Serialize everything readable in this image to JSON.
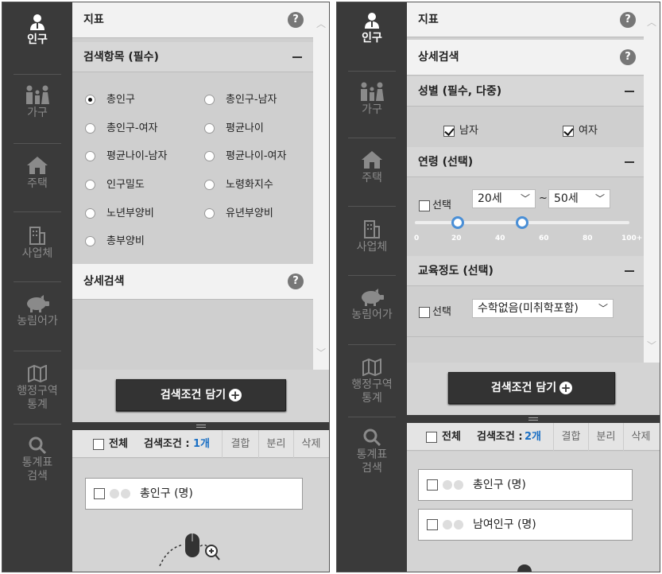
{
  "sidebar": {
    "items": [
      {
        "label": "인구",
        "icon": "person-icon"
      },
      {
        "label": "가구",
        "icon": "family-icon"
      },
      {
        "label": "주택",
        "icon": "house-icon"
      },
      {
        "label": "사업체",
        "icon": "building-icon"
      },
      {
        "label": "농림어가",
        "icon": "pig-icon"
      },
      {
        "label_line1": "행정구역",
        "label_line2": "통계",
        "icon": "map-icon"
      },
      {
        "label_line1": "통계표",
        "label_line2": "검색",
        "icon": "search-icon"
      }
    ]
  },
  "left": {
    "indicator_title": "지표",
    "search_items_title": "검색항목 (필수)",
    "radios": [
      {
        "label": "총인구",
        "checked": true
      },
      {
        "label": "총인구-남자",
        "checked": false
      },
      {
        "label": "총인구-여자",
        "checked": false
      },
      {
        "label": "평균나이",
        "checked": false
      },
      {
        "label": "평균나이-남자",
        "checked": false
      },
      {
        "label": "평균나이-여자",
        "checked": false
      },
      {
        "label": "인구밀도",
        "checked": false
      },
      {
        "label": "노령화지수",
        "checked": false
      },
      {
        "label": "노년부양비",
        "checked": false
      },
      {
        "label": "유년부양비",
        "checked": false
      },
      {
        "label": "총부양비",
        "checked": false
      }
    ],
    "detail_title": "상세검색",
    "add_button": "검색조건 담기",
    "select_all": "전체",
    "condition_label": "검색조건 : ",
    "condition_count": "1개",
    "actions": [
      "결합",
      "분리",
      "삭제"
    ],
    "result_items": [
      "총인구 (명)"
    ]
  },
  "right": {
    "indicator_title": "지표",
    "detail_title": "상세검색",
    "gender_title": "성별 (필수, 다중)",
    "gender": [
      {
        "label": "남자",
        "checked": true
      },
      {
        "label": "여자",
        "checked": true
      }
    ],
    "age_title": "연령 (선택)",
    "age_select_label": "선택",
    "age_from": "20세",
    "age_to": "50세",
    "age_tilde": "~",
    "age_ticks": [
      "0",
      "20",
      "40",
      "60",
      "80",
      "100+"
    ],
    "age_range": [
      20,
      50
    ],
    "edu_title": "교육정도 (선택)",
    "edu_select_label": "선택",
    "edu_value": "수학없음(미취학포함)",
    "add_button": "검색조건 담기",
    "select_all": "전체",
    "condition_label": "검색조건 : ",
    "condition_count": "2개",
    "actions": [
      "결합",
      "분리",
      "삭제"
    ],
    "result_items": [
      "총인구 (명)",
      "남여인구 (명)"
    ]
  },
  "colors": {
    "sidebar": "#3a3a3a",
    "accent_count": "#1a6fc4",
    "slider_handle": "#4a8fd6"
  }
}
